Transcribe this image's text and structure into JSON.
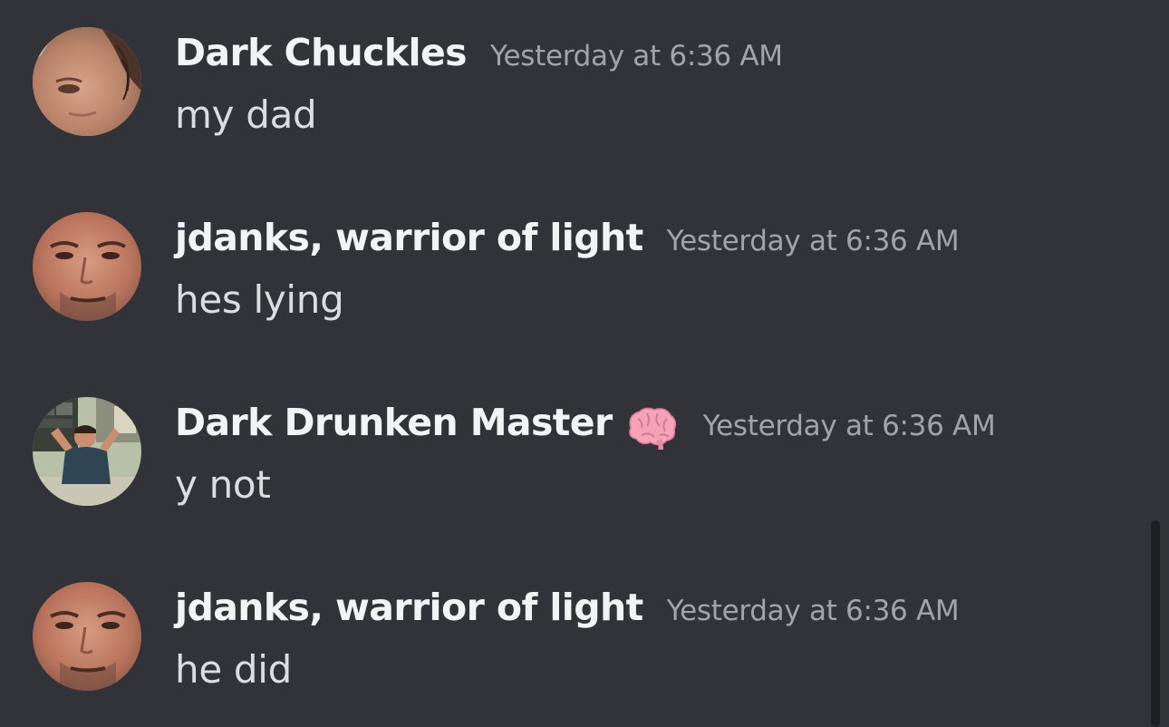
{
  "messages": [
    {
      "author": "Dark Chuckles",
      "timestamp": "Yesterday at 6:36 AM",
      "content": "my dad",
      "avatar_icon": "avatar-woman-photo"
    },
    {
      "author": "jdanks, warrior of light",
      "timestamp": "Yesterday at 6:36 AM",
      "content": "hes lying",
      "avatar_icon": "avatar-man-face-closeup"
    },
    {
      "author": "Dark Drunken Master",
      "author_emoji": "brain-emoji",
      "timestamp": "Yesterday at 6:36 AM",
      "content": "y not",
      "avatar_icon": "avatar-man-stretching-photo"
    },
    {
      "author": "jdanks, warrior of light",
      "timestamp": "Yesterday at 6:36 AM",
      "content": "he did",
      "avatar_icon": "avatar-man-face-closeup"
    }
  ],
  "colors": {
    "background": "#313338",
    "username": "#f2f3f5",
    "timestamp": "#a1a4ab",
    "message_text": "#dbdee1",
    "scrollbar": "#1e1f22"
  }
}
